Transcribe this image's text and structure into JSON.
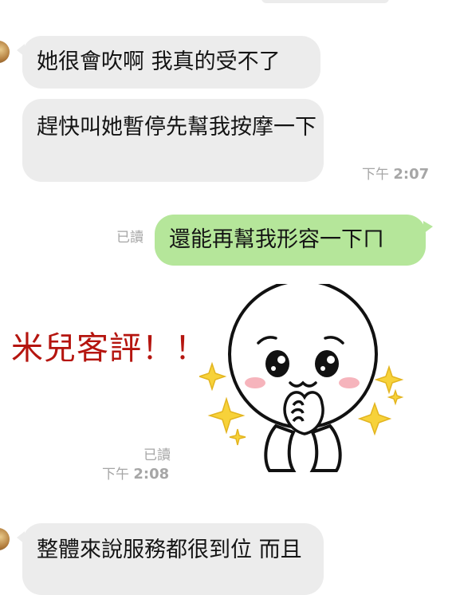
{
  "messages": {
    "m1": "她很會吹啊 我真的受不了",
    "m2": "趕快叫她暫停先幫我按摩一下",
    "m2_time_prefix": "下午",
    "m2_time": "2:07",
    "m3_read": "已讀",
    "m3": "還能再幫我形容一下ㄇ",
    "sticker_read": "已讀",
    "sticker_time_prefix": "下午",
    "sticker_time": "2:08",
    "m4": "整體來說服務都很到位 而且"
  },
  "overlay": {
    "review_text": "米兒客評！！"
  },
  "colors": {
    "incoming_bubble": "#ececec",
    "outgoing_bubble": "#b5e69a",
    "review_text": "#b5150f",
    "meta_text": "#a6a6a6"
  },
  "icons": {
    "sticker": "moon-sticker-pleading",
    "sparkle": "sparkle-icon"
  }
}
